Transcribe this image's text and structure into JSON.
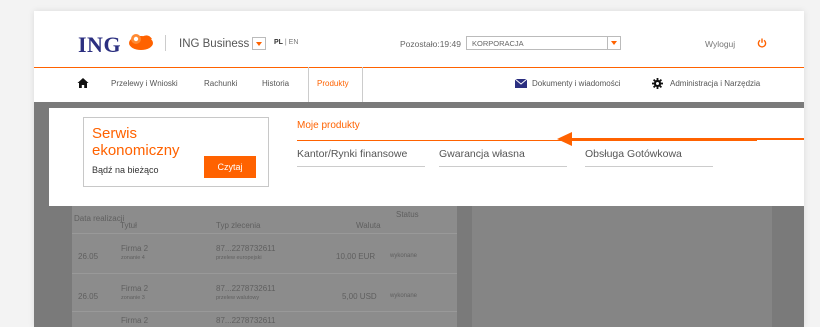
{
  "header": {
    "logo_text": "ING",
    "app_name": "ING Business",
    "lang_pl": "PL",
    "lang_sep": " | ",
    "lang_en": "EN",
    "remaining_time": "Pozostało:19:49",
    "org_select_value": "KORPORACJA",
    "logout": "Wyloguj"
  },
  "nav": {
    "items": [
      "Przelewy i Wnioski",
      "Rachunki",
      "Historia",
      "Produkty"
    ],
    "active": "Produkty",
    "documents": "Dokumenty i wiadomości",
    "admin": "Administracja i Narzędzia"
  },
  "dropdown": {
    "promo": {
      "title": "Serwis ekonomiczny",
      "subtitle": "Bądź na bieżąco",
      "button": "Czytaj"
    },
    "section_title": "Moje produkty",
    "items": [
      "Kantor/Rynki finansowe",
      "Gwarancja własna",
      "Obsługa Gotówkowa"
    ]
  },
  "background_table": {
    "headers": [
      "Data realizacji",
      "Tytuł",
      "Typ zlecenia",
      "Waluta",
      "Status"
    ],
    "rows": [
      {
        "date": "26.05",
        "title": "Firma 2",
        "sub": "zonanie 4",
        "account": "87...2278732611",
        "type": "przelew europejski",
        "amount": "10,00 EUR",
        "status": "wykonane"
      },
      {
        "date": "26.05",
        "title": "Firma 2",
        "sub": "zonanie 3",
        "account": "87...2278732611",
        "type": "przelew walutowy",
        "amount": "5,00 USD",
        "status": "wykonane"
      },
      {
        "date": "",
        "title": "Firma 2",
        "sub": "",
        "account": "87...2278732611",
        "type": "",
        "amount": "",
        "status": ""
      }
    ]
  },
  "colors": {
    "accent": "#ff6200",
    "brand": "#2b2f80"
  }
}
